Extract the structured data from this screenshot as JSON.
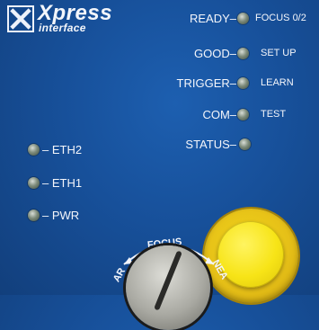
{
  "logo": {
    "brand": "Xpress",
    "sub": "interface"
  },
  "status_labels": {
    "ready": "READY–",
    "good": "GOOD–",
    "trigger": "TRIGGER–",
    "com": "COM–",
    "status": "STATUS–"
  },
  "mode_labels": {
    "focus": "FOCUS",
    "focus_value": "0/2",
    "setup": "SET UP",
    "learn": "LEARN",
    "test": "TEST"
  },
  "port_labels": {
    "eth2": "– ETH2",
    "eth1": "– ETH1",
    "pwr": "– PWR"
  },
  "dial": {
    "label": "FOCUS",
    "left_label": "AR",
    "right_label": "NEA"
  },
  "colors": {
    "panel": "#17509a",
    "button": "#f7e417",
    "led_off": "#7e8c7c"
  }
}
